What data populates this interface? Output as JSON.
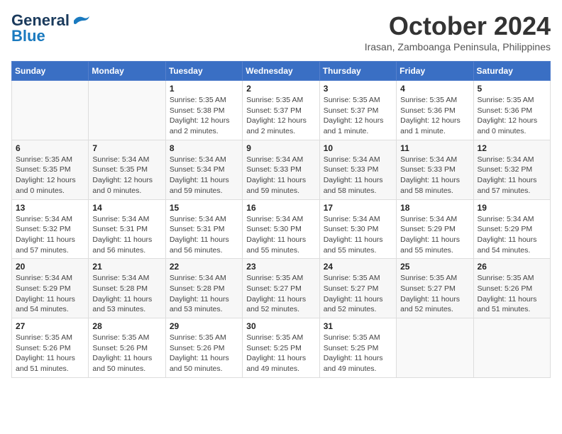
{
  "header": {
    "logo_general": "General",
    "logo_blue": "Blue",
    "month_title": "October 2024",
    "location": "Irasan, Zamboanga Peninsula, Philippines"
  },
  "calendar": {
    "days_of_week": [
      "Sunday",
      "Monday",
      "Tuesday",
      "Wednesday",
      "Thursday",
      "Friday",
      "Saturday"
    ],
    "weeks": [
      [
        {
          "day": "",
          "content": ""
        },
        {
          "day": "",
          "content": ""
        },
        {
          "day": "1",
          "content": "Sunrise: 5:35 AM\nSunset: 5:38 PM\nDaylight: 12 hours and 2 minutes."
        },
        {
          "day": "2",
          "content": "Sunrise: 5:35 AM\nSunset: 5:37 PM\nDaylight: 12 hours and 2 minutes."
        },
        {
          "day": "3",
          "content": "Sunrise: 5:35 AM\nSunset: 5:37 PM\nDaylight: 12 hours and 1 minute."
        },
        {
          "day": "4",
          "content": "Sunrise: 5:35 AM\nSunset: 5:36 PM\nDaylight: 12 hours and 1 minute."
        },
        {
          "day": "5",
          "content": "Sunrise: 5:35 AM\nSunset: 5:36 PM\nDaylight: 12 hours and 0 minutes."
        }
      ],
      [
        {
          "day": "6",
          "content": "Sunrise: 5:35 AM\nSunset: 5:35 PM\nDaylight: 12 hours and 0 minutes."
        },
        {
          "day": "7",
          "content": "Sunrise: 5:34 AM\nSunset: 5:35 PM\nDaylight: 12 hours and 0 minutes."
        },
        {
          "day": "8",
          "content": "Sunrise: 5:34 AM\nSunset: 5:34 PM\nDaylight: 11 hours and 59 minutes."
        },
        {
          "day": "9",
          "content": "Sunrise: 5:34 AM\nSunset: 5:33 PM\nDaylight: 11 hours and 59 minutes."
        },
        {
          "day": "10",
          "content": "Sunrise: 5:34 AM\nSunset: 5:33 PM\nDaylight: 11 hours and 58 minutes."
        },
        {
          "day": "11",
          "content": "Sunrise: 5:34 AM\nSunset: 5:33 PM\nDaylight: 11 hours and 58 minutes."
        },
        {
          "day": "12",
          "content": "Sunrise: 5:34 AM\nSunset: 5:32 PM\nDaylight: 11 hours and 57 minutes."
        }
      ],
      [
        {
          "day": "13",
          "content": "Sunrise: 5:34 AM\nSunset: 5:32 PM\nDaylight: 11 hours and 57 minutes."
        },
        {
          "day": "14",
          "content": "Sunrise: 5:34 AM\nSunset: 5:31 PM\nDaylight: 11 hours and 56 minutes."
        },
        {
          "day": "15",
          "content": "Sunrise: 5:34 AM\nSunset: 5:31 PM\nDaylight: 11 hours and 56 minutes."
        },
        {
          "day": "16",
          "content": "Sunrise: 5:34 AM\nSunset: 5:30 PM\nDaylight: 11 hours and 55 minutes."
        },
        {
          "day": "17",
          "content": "Sunrise: 5:34 AM\nSunset: 5:30 PM\nDaylight: 11 hours and 55 minutes."
        },
        {
          "day": "18",
          "content": "Sunrise: 5:34 AM\nSunset: 5:29 PM\nDaylight: 11 hours and 55 minutes."
        },
        {
          "day": "19",
          "content": "Sunrise: 5:34 AM\nSunset: 5:29 PM\nDaylight: 11 hours and 54 minutes."
        }
      ],
      [
        {
          "day": "20",
          "content": "Sunrise: 5:34 AM\nSunset: 5:29 PM\nDaylight: 11 hours and 54 minutes."
        },
        {
          "day": "21",
          "content": "Sunrise: 5:34 AM\nSunset: 5:28 PM\nDaylight: 11 hours and 53 minutes."
        },
        {
          "day": "22",
          "content": "Sunrise: 5:34 AM\nSunset: 5:28 PM\nDaylight: 11 hours and 53 minutes."
        },
        {
          "day": "23",
          "content": "Sunrise: 5:35 AM\nSunset: 5:27 PM\nDaylight: 11 hours and 52 minutes."
        },
        {
          "day": "24",
          "content": "Sunrise: 5:35 AM\nSunset: 5:27 PM\nDaylight: 11 hours and 52 minutes."
        },
        {
          "day": "25",
          "content": "Sunrise: 5:35 AM\nSunset: 5:27 PM\nDaylight: 11 hours and 52 minutes."
        },
        {
          "day": "26",
          "content": "Sunrise: 5:35 AM\nSunset: 5:26 PM\nDaylight: 11 hours and 51 minutes."
        }
      ],
      [
        {
          "day": "27",
          "content": "Sunrise: 5:35 AM\nSunset: 5:26 PM\nDaylight: 11 hours and 51 minutes."
        },
        {
          "day": "28",
          "content": "Sunrise: 5:35 AM\nSunset: 5:26 PM\nDaylight: 11 hours and 50 minutes."
        },
        {
          "day": "29",
          "content": "Sunrise: 5:35 AM\nSunset: 5:26 PM\nDaylight: 11 hours and 50 minutes."
        },
        {
          "day": "30",
          "content": "Sunrise: 5:35 AM\nSunset: 5:25 PM\nDaylight: 11 hours and 49 minutes."
        },
        {
          "day": "31",
          "content": "Sunrise: 5:35 AM\nSunset: 5:25 PM\nDaylight: 11 hours and 49 minutes."
        },
        {
          "day": "",
          "content": ""
        },
        {
          "day": "",
          "content": ""
        }
      ]
    ]
  }
}
